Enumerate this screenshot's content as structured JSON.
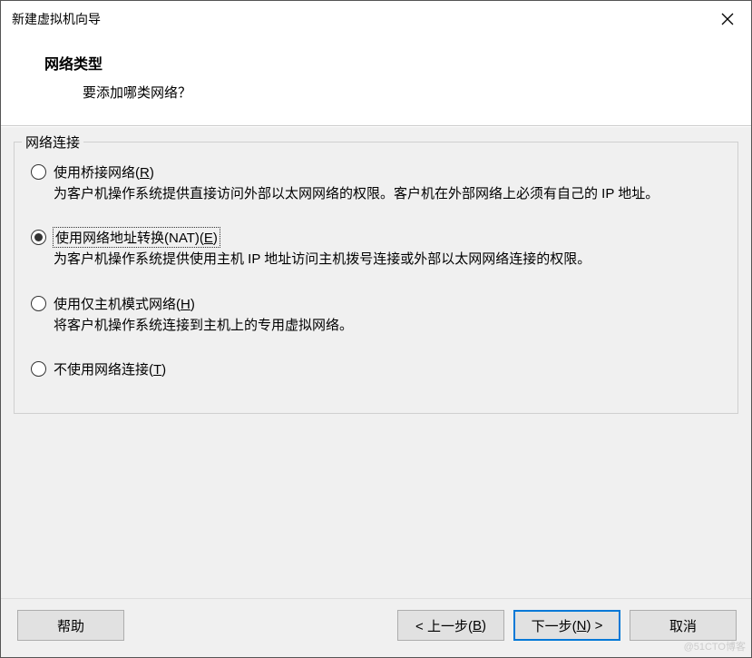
{
  "window": {
    "title": "新建虚拟机向导"
  },
  "header": {
    "heading": "网络类型",
    "subheading": "要添加哪类网络？"
  },
  "fieldset": {
    "legend": "网络连接",
    "options": [
      {
        "label_pre": "使用桥接网络(",
        "hotkey": "R",
        "label_post": ")",
        "desc": "为客户机操作系统提供直接访问外部以太网网络的权限。客户机在外部网络上必须有自己的 IP 地址。",
        "checked": false,
        "focused": false
      },
      {
        "label_pre": "使用网络地址转换(NAT)(",
        "hotkey": "E",
        "label_post": ")",
        "desc": "为客户机操作系统提供使用主机 IP 地址访问主机拨号连接或外部以太网网络连接的权限。",
        "checked": true,
        "focused": true
      },
      {
        "label_pre": "使用仅主机模式网络(",
        "hotkey": "H",
        "label_post": ")",
        "desc": "将客户机操作系统连接到主机上的专用虚拟网络。",
        "checked": false,
        "focused": false
      },
      {
        "label_pre": "不使用网络连接(",
        "hotkey": "T",
        "label_post": ")",
        "desc": "",
        "checked": false,
        "focused": false
      }
    ]
  },
  "footer": {
    "help": "帮助",
    "back_pre": "< 上一步(",
    "back_key": "B",
    "back_post": ")",
    "next_pre": "下一步(",
    "next_key": "N",
    "next_post": ") >",
    "cancel": "取消"
  },
  "watermark": "@51CTO博客"
}
